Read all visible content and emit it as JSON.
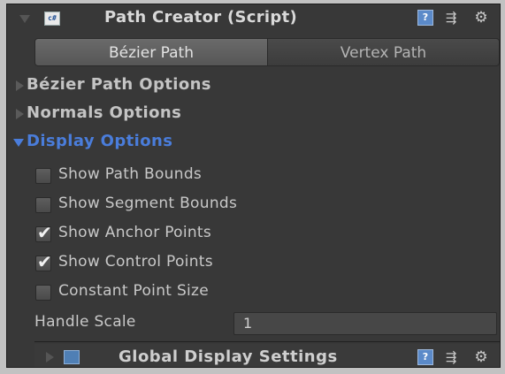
{
  "header": {
    "title": "Path Creator (Script)",
    "script_icon_text": "c#",
    "icons": [
      "foldout-arrow-icon",
      "script-icon",
      "help-reference-icon",
      "preset-icon",
      "gear-icon"
    ]
  },
  "tabs": [
    {
      "label": "Bézier Path",
      "active": true
    },
    {
      "label": "Vertex Path",
      "active": false
    }
  ],
  "foldouts": {
    "bezier": {
      "label": "Bézier Path Options",
      "expanded": false
    },
    "normals": {
      "label": "Normals Options",
      "expanded": false
    },
    "display": {
      "label": "Display Options",
      "expanded": true
    }
  },
  "display_options": {
    "toggles": [
      {
        "label": "Show Path Bounds",
        "checked": false
      },
      {
        "label": "Show Segment Bounds",
        "checked": false
      },
      {
        "label": "Show Anchor Points",
        "checked": true
      },
      {
        "label": "Show Control Points",
        "checked": true
      },
      {
        "label": "Constant Point Size",
        "checked": false
      }
    ],
    "handle_scale": {
      "label": "Handle Scale",
      "value": "1"
    }
  },
  "global_settings": {
    "title": "Global Display Settings",
    "icons": [
      "foldout-arrow-icon",
      "settings-asset-icon",
      "help-reference-icon",
      "preset-icon",
      "gear-icon"
    ]
  },
  "colors": {
    "panel_bg": "#383838",
    "accent_blue": "#4a7ddb",
    "text": "#c8c8c8"
  }
}
